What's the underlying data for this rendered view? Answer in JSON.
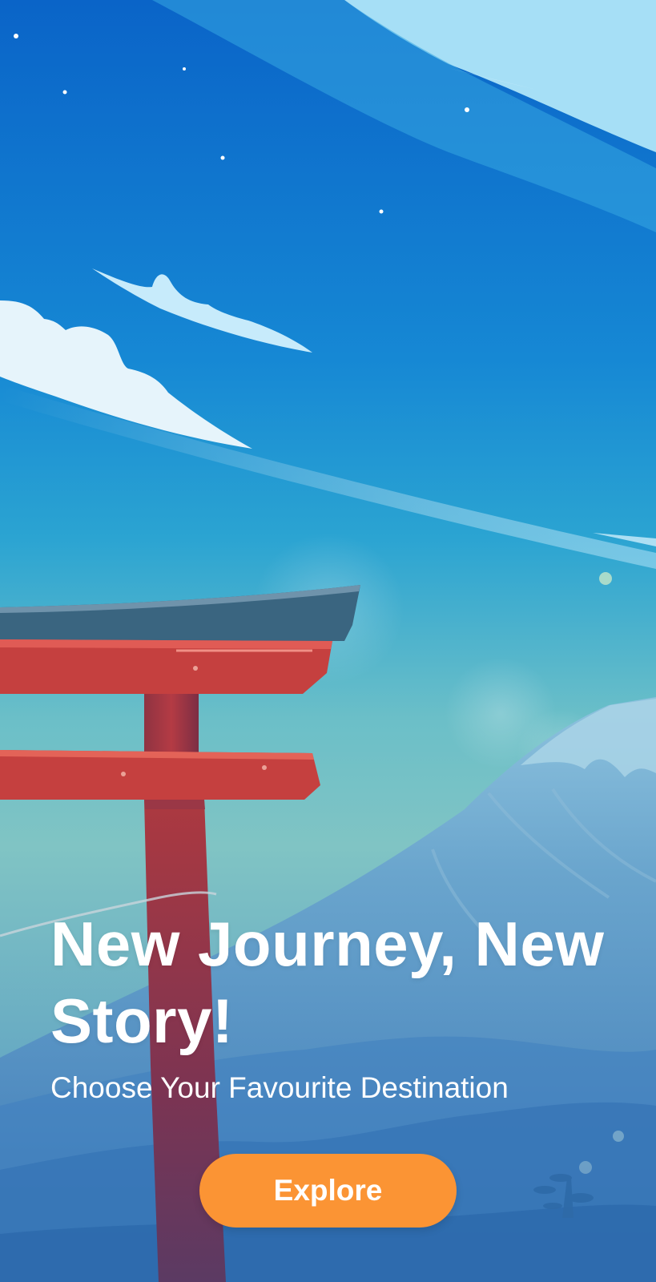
{
  "screen": {
    "title": "New Journey, New Story!",
    "subtitle": "Choose Your Favourite Destination",
    "explore_label": "Explore"
  },
  "illustration": {
    "name": "torii-gate-mount-fuji-illustration",
    "colors": {
      "sky_top": "#0a64c8",
      "sky_mid": "#1a9fd8",
      "sky_low": "#72c3c5",
      "torii_red": "#c5403f",
      "torii_roof": "#3a6580",
      "mountain": "#5e97c3",
      "button": "#fb9434"
    }
  }
}
